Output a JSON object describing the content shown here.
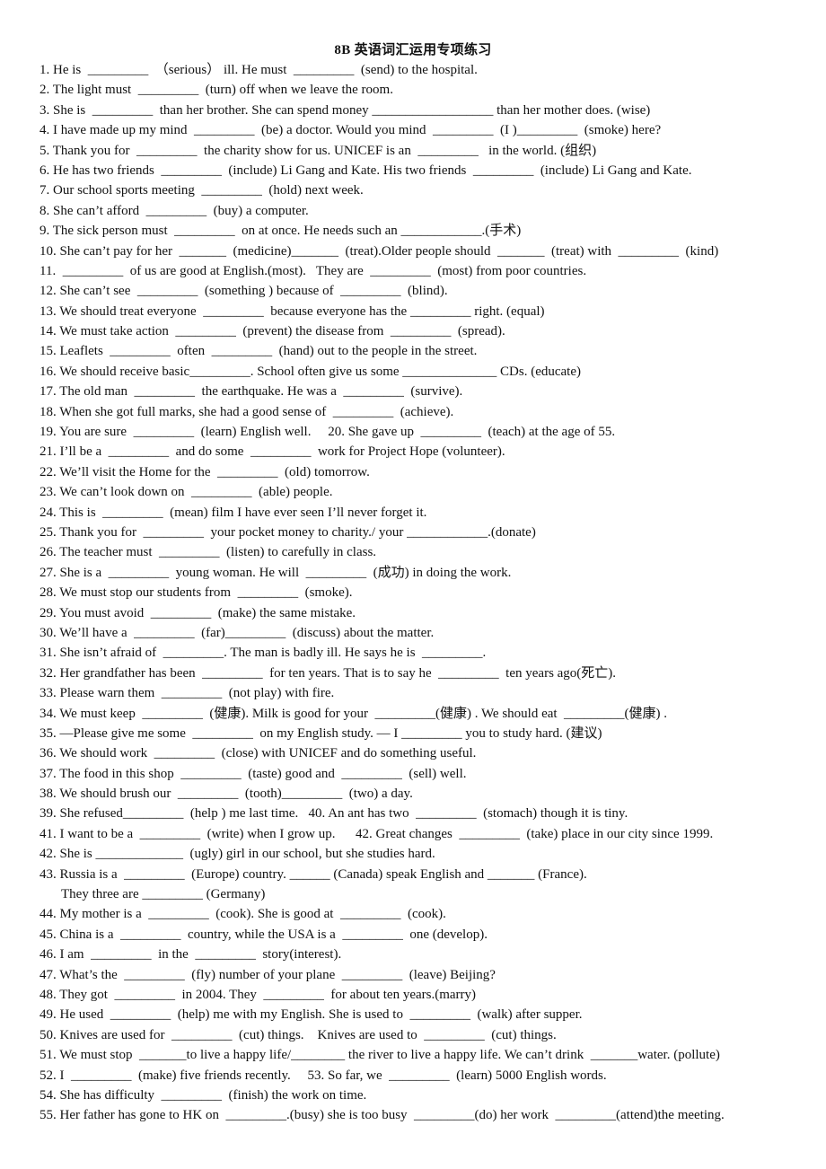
{
  "document": {
    "title": "8B 英语词汇运用专项练习",
    "lines": [
      "1. He is  _________  （serious） ill. He must  _________  (send) to the hospital.",
      "2. The light must  _________  (turn) off when we leave the room.",
      "3. She is  _________  than her brother. She can spend money __________________ than her mother does. (wise)",
      "4. I have made up my mind  _________  (be) a doctor. Would you mind  _________  (I )_________  (smoke) here?",
      "5. Thank you for  _________  the charity show for us. UNICEF is an  _________   in the world. (组织)",
      "6. He has two friends  _________  (include) Li Gang and Kate. His two friends  _________  (include) Li Gang and Kate.",
      "7. Our school sports meeting  _________  (hold) next week.",
      "8. She can’t afford  _________  (buy) a computer.",
      "9. The sick person must  _________  on at once. He needs such an ____________.(手术)",
      "10. She can’t pay for her  _______  (medicine)_______  (treat).Older people should  _______  (treat) with  _________  (kind)",
      "11.  _________  of us are good at English.(most).   They are  _________  (most) from poor countries.",
      "12. She can’t see  _________  (something ) because of  _________  (blind).",
      "13. We should treat everyone  _________  because everyone has the _________ right. (equal)",
      "14. We must take action  _________  (prevent) the disease from  _________  (spread).",
      "15. Leaflets  _________  often  _________  (hand) out to the people in the street.",
      "16. We should receive basic_________. School often give us some ______________ CDs. (educate)",
      "17. The old man  _________  the earthquake. He was a  _________  (survive).",
      "18. When she got full marks, she had a good sense of  _________  (achieve).",
      "19. You are sure  _________  (learn) English well.     20. She gave up  _________  (teach) at the age of 55.",
      "21. I’ll be a  _________  and do some  _________  work for Project Hope (volunteer).",
      "22. We’ll visit the Home for the  _________  (old) tomorrow.",
      "23. We can’t look down on  _________  (able) people.",
      "24. This is  _________  (mean) film I have ever seen I’ll never forget it.",
      "25. Thank you for  _________  your pocket money to charity./ your ____________.(donate)",
      "26. The teacher must  _________  (listen) to carefully in class.",
      "27. She is a  _________  young woman. He will  _________  (成功) in doing the work.",
      "28. We must stop our students from  _________  (smoke).",
      "29. You must avoid  _________  (make) the same mistake.",
      "30. We’ll have a  _________  (far)_________  (discuss) about the matter.",
      "31. She isn’t afraid of  _________. The man is badly ill. He says he is  _________.",
      "32. Her grandfather has been  _________  for ten years. That is to say he  _________  ten years ago(死亡).",
      "33. Please warn them  _________  (not play) with fire.",
      "34. We must keep  _________  (健康). Milk is good for your  _________(健康) . We should eat  _________(健康) .",
      "35. —Please give me some  _________  on my English study. — I _________ you to study hard. (建议)",
      "36. We should work  _________  (close) with UNICEF and do something useful.",
      "37. The food in this shop  _________  (taste) good and  _________  (sell) well.",
      "38. We should brush our  _________  (tooth)_________  (two) a day.",
      "39. She refused_________  (help ) me last time.   40. An ant has two  _________  (stomach) though it is tiny.",
      "41. I want to be a  _________  (write) when I grow up.      42. Great changes  _________  (take) place in our city since 1999.",
      "42. She is _____________  (ugly) girl in our school, but she studies hard.",
      "43. Russia is a  _________  (Europe) country. ______ (Canada) speak English and _______ (France).",
      "They three are _________ (Germany)",
      "44. My mother is a  _________  (cook). She is good at  _________  (cook).",
      "45. China is a  _________  country, while the USA is a  _________  one (develop).",
      "46. I am  _________  in the  _________  story(interest).",
      "47. What’s the  _________  (fly) number of your plane  _________  (leave) Beijing?",
      "48. They got  _________  in 2004. They  _________  for about ten years.(marry)",
      "49. He used  _________  (help) me with my English. She is used to  _________  (walk) after supper.",
      "50. Knives are used for  _________  (cut) things.    Knives are used to  _________  (cut) things.",
      "51. We must stop  _______to live a happy life/________ the river to live a happy life. We can’t drink  _______water. (pollute)",
      "52. I  _________  (make) five friends recently.     53. So far, we  _________  (learn) 5000 English words.",
      "54. She has difficulty  _________  (finish) the work on time.",
      "55. Her father has gone to HK on  _________.(busy) she is too busy  _________(do) her work  _________(attend)the meeting."
    ]
  }
}
